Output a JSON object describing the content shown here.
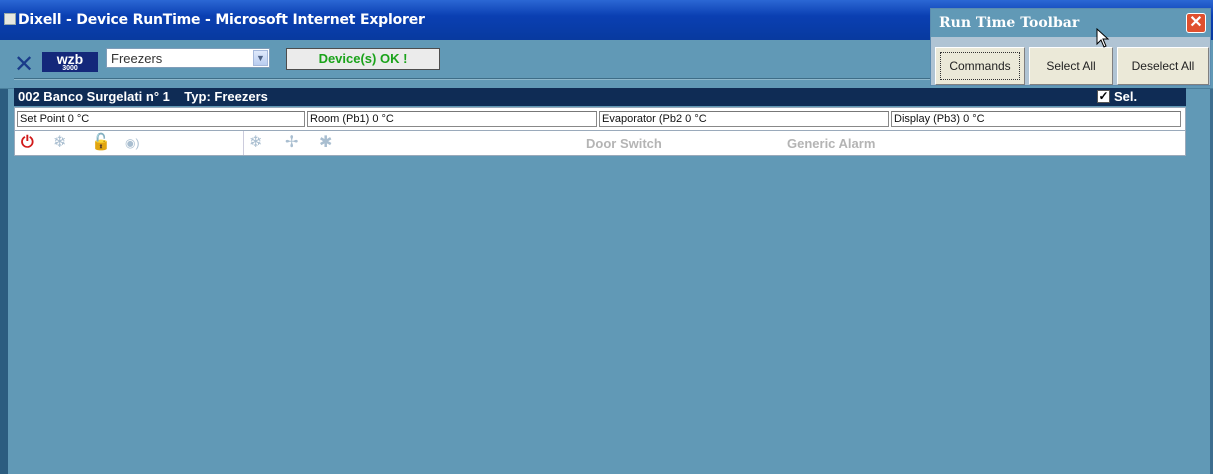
{
  "window": {
    "title": "Dixell - Device RunTime - Microsoft Internet Explorer"
  },
  "logo": {
    "text": "wzb",
    "subtext": "3000"
  },
  "device_select": {
    "value": "Freezers"
  },
  "status": {
    "text": "Device(s) OK !"
  },
  "runtime_toolbar": {
    "title": "Run Time Toolbar",
    "buttons": [
      "Commands",
      "Select All",
      "Deselect All"
    ]
  },
  "device": {
    "header": "002 Banco Surgelati n° 1    Typ: Freezers",
    "selected": true,
    "sel_label": "Sel.",
    "probes": [
      {
        "label": "Set Point   0 °C"
      },
      {
        "label": "Room (Pb1)   0 °C"
      },
      {
        "label": "Evaporator (Pb2   0 °C"
      },
      {
        "label": "Display (Pb3)   0 °C"
      }
    ],
    "indicators": [
      "Door Switch",
      "Generic Alarm"
    ]
  },
  "colors": {
    "titlebar": "#0a3fb2",
    "background": "#6199b6",
    "device_header": "#0f2c55",
    "status_ok": "#1aa31a",
    "power_icon": "#d11a1a",
    "lock_icon": "#3a9a1a"
  },
  "icons": [
    "ie-icon",
    "power-icon",
    "snowflake-icon",
    "lock-icon",
    "light-icon",
    "defrost-icon",
    "fan-icon",
    "snowflake-icon",
    "close-icon",
    "checkbox-icon",
    "dropdown-arrow-icon",
    "mouse-cursor-icon"
  ]
}
